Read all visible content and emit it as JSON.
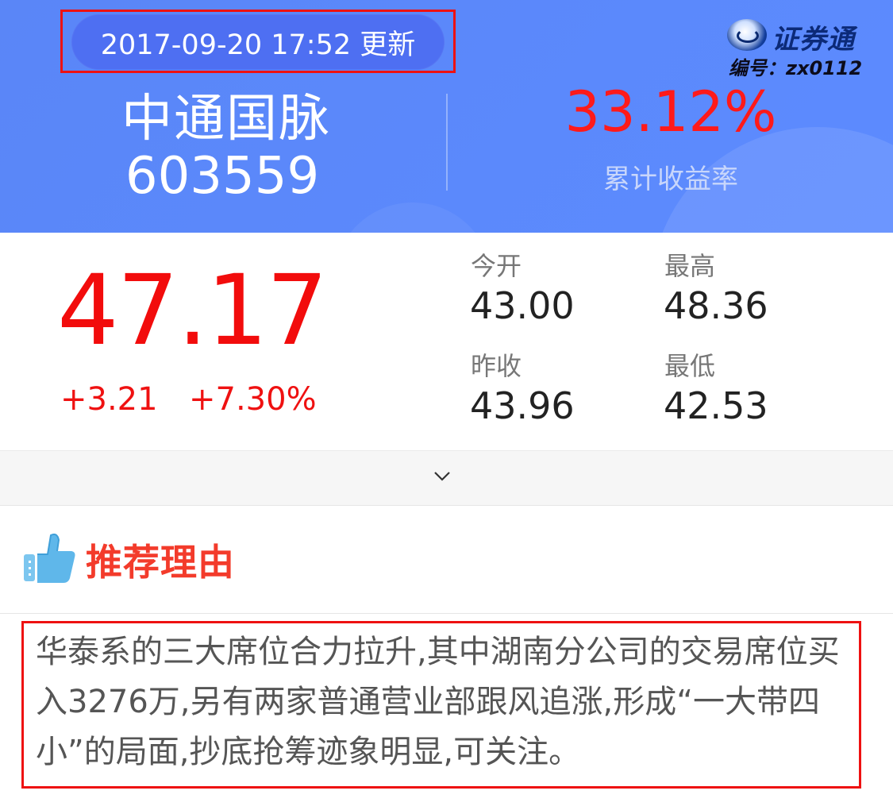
{
  "header": {
    "update_time": "2017-09-20 17:52 更新",
    "stock_name": "中通国脉",
    "stock_code": "603559",
    "cumulative_return": "33.12%",
    "cumulative_return_label": "累计收益率",
    "logo": {
      "name": "证券通",
      "code": "编号：zx0112"
    }
  },
  "quote": {
    "price": "47.17",
    "change": "+3.21",
    "change_pct": "+7.30%",
    "stats": [
      {
        "label": "今开",
        "value": "43.00"
      },
      {
        "label": "最高",
        "value": "48.36"
      },
      {
        "label": "昨收",
        "value": "43.96"
      },
      {
        "label": "最低",
        "value": "42.53"
      }
    ]
  },
  "expand": {
    "icon": "chevron-down-icon"
  },
  "reason": {
    "title": "推荐理由",
    "icon": "thumbs-up-icon",
    "text": "华泰系的三大席位合力拉升,其中湖南分公司的交易席位买入3276万,另有两家普通营业部跟风追涨,形成“一大带四小”的局面,抄底抢筹迹象明显,可关注。"
  },
  "colors": {
    "header_bg": "#5c8bff",
    "price_red": "#f20c0c",
    "title_red": "#f33b2b",
    "highlight_box": "#ee1111"
  }
}
